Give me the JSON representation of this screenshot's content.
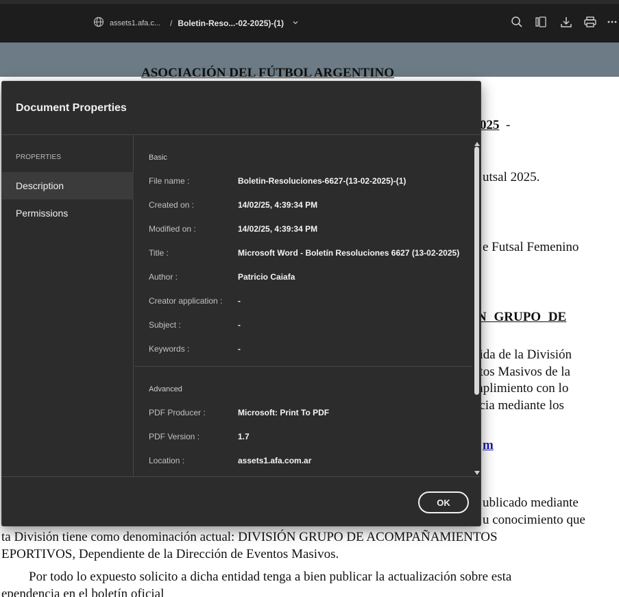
{
  "toolbar": {
    "site": "assets1.afa.c...",
    "separator": "/",
    "document": "Boletin-Reso...-02-2025)-(1)",
    "icons": [
      "globe-icon",
      "chevron-down-icon",
      "search-icon",
      "pages-icon",
      "download-icon",
      "print-icon",
      "more-icon"
    ]
  },
  "document_bg": {
    "lines": [
      "ASOCIACIÓN DEL FÚTBOL ARGENTINO",
      "025",
      "-",
      "utsal 2025.",
      "e Futsal Femenino",
      "N   GRUPO   DE",
      "bida de la División",
      "ntos Masivos de la",
      "mplimiento con lo",
      "ncia  mediante  los",
      "m",
      "ublicado mediante",
      "u conocimiento que",
      "ta División tiene como denominación actual: DIVISIÓN GRUPO DE ACOMPAÑAMIENTOS",
      "EPORTIVOS, Dependiente de la Dirección de Eventos Masivos.",
      "Por todo lo expuesto solicito a dicha entidad tenga a bien publicar la actualización sobre esta",
      "ependencia en el boletín oficial"
    ]
  },
  "dialog": {
    "title": "Document Properties",
    "sidebar": {
      "heading": "PROPERTIES",
      "items": [
        {
          "label": "Description",
          "active": true
        },
        {
          "label": "Permissions",
          "active": false
        }
      ]
    },
    "basic": {
      "heading": "Basic",
      "rows": [
        {
          "label": "File name :",
          "value": "Boletin-Resoluciones-6627-(13-02-2025)-(1)"
        },
        {
          "label": "Created on :",
          "value": "14/02/25, 4:39:34 PM"
        },
        {
          "label": "Modified on :",
          "value": "14/02/25, 4:39:34 PM"
        },
        {
          "label": "Title :",
          "value": "Microsoft Word - Boletín Resoluciones 6627 (13-02-2025)"
        },
        {
          "label": "Author :",
          "value": "Patricio Caiafa"
        },
        {
          "label": "Creator application :",
          "value": "-"
        },
        {
          "label": "Subject :",
          "value": "-"
        },
        {
          "label": "Keywords :",
          "value": "-"
        }
      ]
    },
    "advanced": {
      "heading": "Advanced",
      "rows": [
        {
          "label": "PDF Producer :",
          "value": "Microsoft: Print To PDF"
        },
        {
          "label": "PDF Version :",
          "value": "1.7"
        },
        {
          "label": "Location :",
          "value": "assets1.afa.com.ar"
        }
      ]
    },
    "ok_label": "OK"
  },
  "colors": {
    "toolbar_bg": "#1d1d1d",
    "dialog_bg": "#2c2c2c",
    "sidebar_active": "#3b3b3b",
    "doc_band": "#6c7b85"
  }
}
